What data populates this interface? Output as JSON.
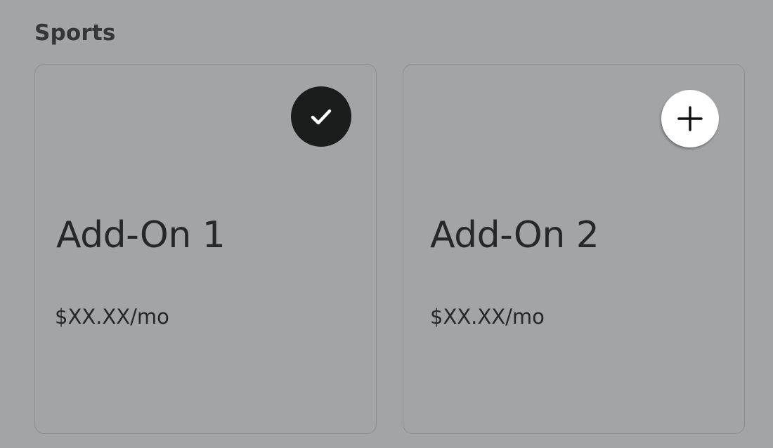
{
  "section": {
    "title": "Sports"
  },
  "addons": [
    {
      "name": "Add-On 1",
      "price": "$XX.XX/mo",
      "selected": true,
      "icon": "checkmark-icon"
    },
    {
      "name": "Add-On 2",
      "price": "$XX.XX/mo",
      "selected": false,
      "icon": "plus-icon"
    }
  ],
  "colors": {
    "background": "#a3a4a6",
    "card_border": "#8e8f91",
    "selected_toggle": "#1b1c1c",
    "unselected_toggle": "#ffffff",
    "text": "#262728"
  }
}
